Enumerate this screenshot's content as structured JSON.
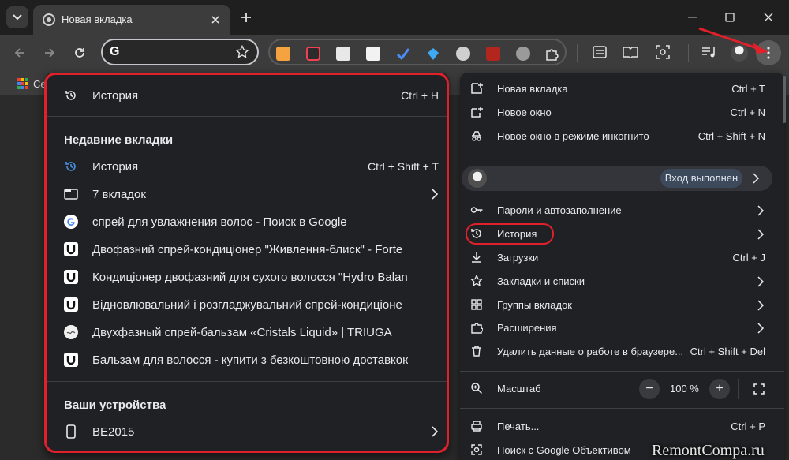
{
  "tab": {
    "title": "Новая вкладка"
  },
  "omnibox": {
    "value": "",
    "placeholder": ""
  },
  "bookmarks_bar": {
    "item_label": "Се"
  },
  "history_submenu": {
    "header": {
      "label": "История",
      "shortcut": "Ctrl + H"
    },
    "recent_heading": "Недавние вкладки",
    "recent_items": [
      {
        "icon": "history-icon",
        "label": "История",
        "shortcut": "Ctrl + Shift + T"
      },
      {
        "icon": "window-icon",
        "label": "7 вкладок"
      },
      {
        "icon": "google-icon",
        "label": "спрей для увлажнения волос - Поиск в Google"
      },
      {
        "icon": "site-u-icon",
        "label": "Двофазний спрей-кондиціонер \"Живлення-блиск\" - Forte"
      },
      {
        "icon": "site-u-icon",
        "label": "Кондиціонер двофазний для сухого волосся \"Hydro Balan"
      },
      {
        "icon": "site-u-icon",
        "label": "Відновлювальний і розгладжувальний спрей-кондиціоне"
      },
      {
        "icon": "triuga-icon",
        "label": "Двухфазный спрей-бальзам «Cristals  Liquid» | TRIUGA"
      },
      {
        "icon": "site-u-icon",
        "label": "Бальзам для волосся - купити з безкоштовною доставкою"
      }
    ],
    "devices_heading": "Ваши устройства",
    "device": {
      "label": "BE2015"
    }
  },
  "main_menu": {
    "new_tab": {
      "label": "Новая вкладка",
      "shortcut": "Ctrl + T"
    },
    "new_window": {
      "label": "Новое окно",
      "shortcut": "Ctrl + N"
    },
    "incognito": {
      "label": "Новое окно в режиме инкогнито",
      "shortcut": "Ctrl + Shift + N"
    },
    "profile": {
      "status": "Вход выполнен"
    },
    "passwords": {
      "label": "Пароли и автозаполнение"
    },
    "history": {
      "label": "История"
    },
    "downloads": {
      "label": "Загрузки",
      "shortcut": "Ctrl + J"
    },
    "bookmarks": {
      "label": "Закладки и списки"
    },
    "tab_groups": {
      "label": "Группы вкладок"
    },
    "extensions": {
      "label": "Расширения"
    },
    "clear_data": {
      "label": "Удалить данные о работе в браузере...",
      "shortcut": "Ctrl + Shift + Del"
    },
    "zoom": {
      "label": "Масштаб",
      "minus": "−",
      "value": "100 %",
      "plus": "+"
    },
    "print": {
      "label": "Печать...",
      "shortcut": "Ctrl + P"
    },
    "google_lens": {
      "label": "Поиск с Google Объективом"
    }
  },
  "watermark": "RemontCompa.ru",
  "colors": {
    "highlight": "#e0202a",
    "menu_bg": "#202124",
    "toolbar": "#3c3c3c"
  }
}
